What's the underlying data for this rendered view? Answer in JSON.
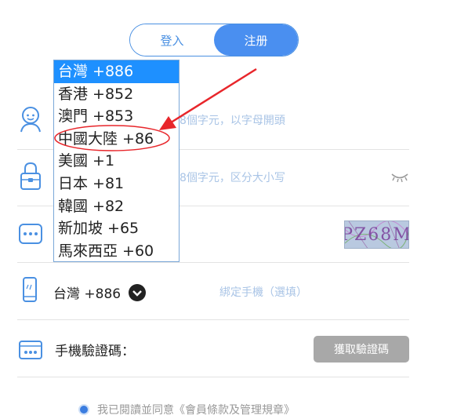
{
  "tabs": {
    "login": "登入",
    "register": "注册"
  },
  "username": {
    "placeholder_visible": "8個字元，以字母開頭"
  },
  "password": {
    "placeholder_visible": "8個字元，区分大小写"
  },
  "phone": {
    "country_code": "台灣 +886",
    "placeholder": "綁定手機（選填）"
  },
  "sms": {
    "label": "手機驗證碼：",
    "button": "獲取驗證碼"
  },
  "captcha": {
    "text": "PZ68M"
  },
  "country_options": [
    "台灣 +886",
    "香港 +852",
    "澳門 +853",
    "中國大陸 +86",
    "美國 +1",
    "日本 +81",
    "韓國 +82",
    "新加坡 +65",
    "馬來西亞 +60"
  ],
  "agreement": "我已閱讀並同意《會員條款及管理規章》",
  "colors": {
    "accent": "#4a8ff0",
    "annotation": "#e8262b",
    "disabled_button": "#a8a8a8"
  }
}
